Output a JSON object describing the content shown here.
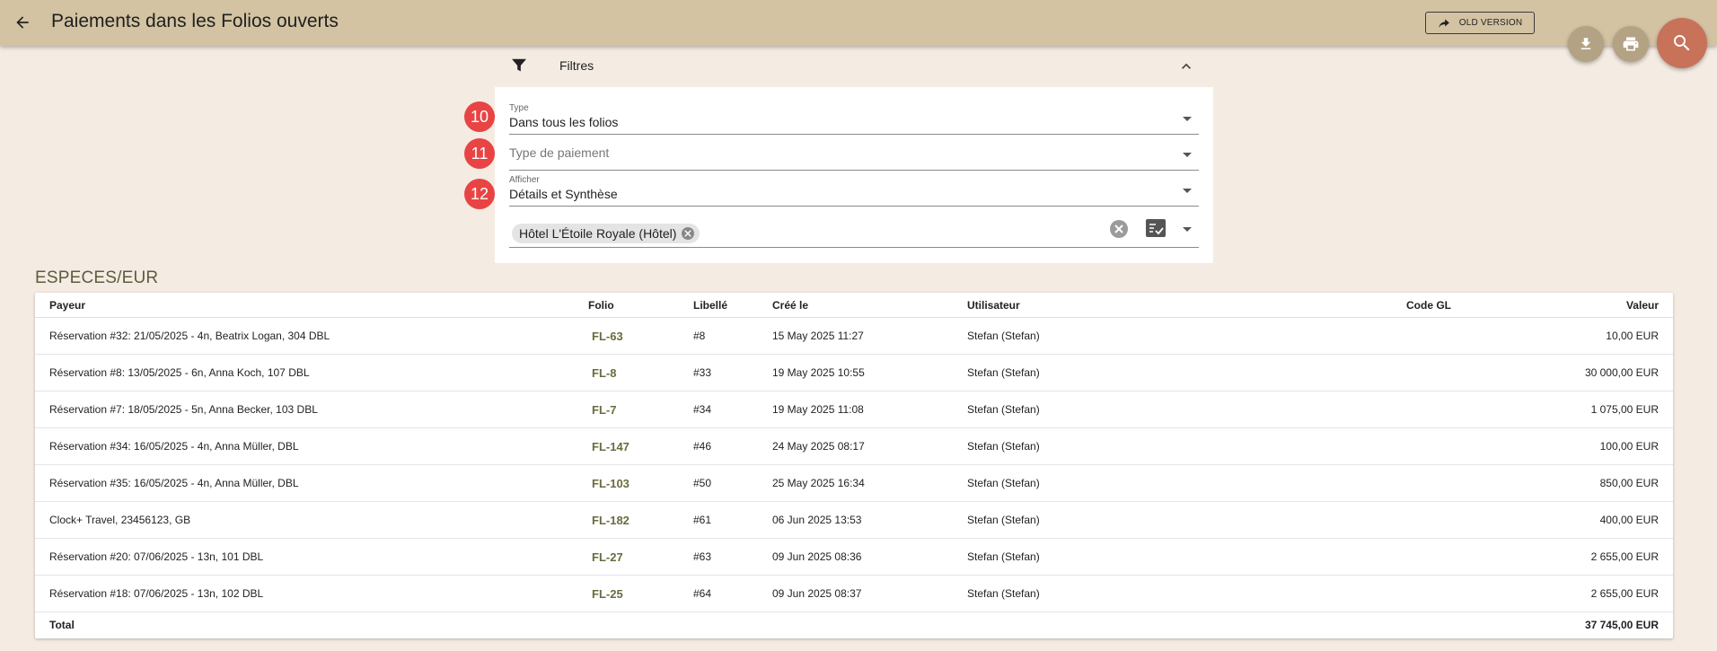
{
  "header": {
    "title": "Paiements dans les Folios ouverts",
    "old_version_label": "OLD VERSION"
  },
  "filters": {
    "label": "Filtres",
    "fields": [
      {
        "badge": "10",
        "label": "Type",
        "value": "Dans tous les folios"
      },
      {
        "badge": "11",
        "placeholder": "Type de paiement"
      },
      {
        "badge": "12",
        "label": "Afficher",
        "value": "Détails et Synthèse"
      }
    ],
    "hotel_chip": "Hôtel L'Étoile Royale (Hôtel)"
  },
  "section": {
    "title": "ESPECES/EUR",
    "columns": [
      "Payeur",
      "Folio",
      "Libellé",
      "Créé le",
      "Utilisateur",
      "Code GL",
      "Valeur"
    ],
    "rows": [
      {
        "payer": "Réservation #32: 21/05/2025 - 4n, Beatrix Logan, 304 DBL",
        "folio": "FL-63",
        "label": "#8",
        "created": "15 May 2025 11:27",
        "user": "Stefan (Stefan)",
        "gl": "",
        "value": "10,00 EUR"
      },
      {
        "payer": "Réservation #8: 13/05/2025 - 6n, Anna Koch, 107 DBL",
        "folio": "FL-8",
        "label": "#33",
        "created": "19 May 2025 10:55",
        "user": "Stefan (Stefan)",
        "gl": "",
        "value": "30 000,00 EUR"
      },
      {
        "payer": "Réservation #7: 18/05/2025 - 5n, Anna Becker, 103 DBL",
        "folio": "FL-7",
        "label": "#34",
        "created": "19 May 2025 11:08",
        "user": "Stefan (Stefan)",
        "gl": "",
        "value": "1 075,00 EUR"
      },
      {
        "payer": "Réservation #34: 16/05/2025 - 4n, Anna Müller, DBL",
        "folio": "FL-147",
        "label": "#46",
        "created": "24 May 2025 08:17",
        "user": "Stefan (Stefan)",
        "gl": "",
        "value": "100,00 EUR"
      },
      {
        "payer": "Réservation #35: 16/05/2025 - 4n, Anna Müller, DBL",
        "folio": "FL-103",
        "label": "#50",
        "created": "25 May 2025 16:34",
        "user": "Stefan (Stefan)",
        "gl": "",
        "value": "850,00 EUR"
      },
      {
        "payer": "Clock+ Travel, 23456123, GB",
        "folio": "FL-182",
        "label": "#61",
        "created": "06 Jun 2025 13:53",
        "user": "Stefan (Stefan)",
        "gl": "",
        "value": "400,00 EUR"
      },
      {
        "payer": "Réservation #20: 07/06/2025 - 13n, 101 DBL",
        "folio": "FL-27",
        "label": "#63",
        "created": "09 Jun 2025 08:36",
        "user": "Stefan (Stefan)",
        "gl": "",
        "value": "2 655,00 EUR"
      },
      {
        "payer": "Réservation #18: 07/06/2025 - 13n, 102 DBL",
        "folio": "FL-25",
        "label": "#64",
        "created": "09 Jun 2025 08:37",
        "user": "Stefan (Stefan)",
        "gl": "",
        "value": "2 655,00 EUR"
      }
    ],
    "total_label": "Total",
    "total_value": "37 745,00 EUR"
  },
  "colors": {
    "topbar": "#d3c3a3",
    "page_bg": "#f4ebe2",
    "badge": "#e84444",
    "search_fab": "#c8725a",
    "action_fab": "#b3a283",
    "folio_link": "#6b6b3e"
  }
}
